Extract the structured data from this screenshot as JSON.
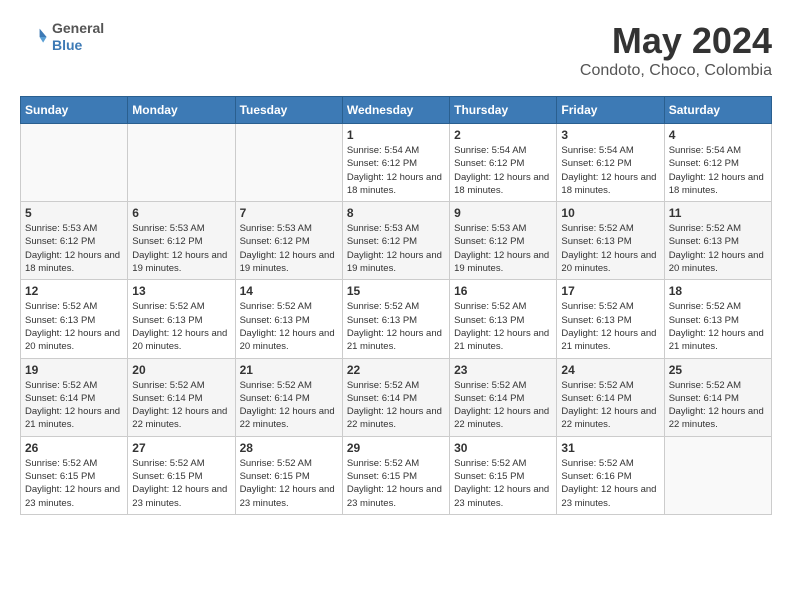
{
  "header": {
    "logo_line1": "General",
    "logo_line2": "Blue",
    "month": "May 2024",
    "location": "Condoto, Choco, Colombia"
  },
  "weekdays": [
    "Sunday",
    "Monday",
    "Tuesday",
    "Wednesday",
    "Thursday",
    "Friday",
    "Saturday"
  ],
  "weeks": [
    [
      {
        "day": "",
        "info": ""
      },
      {
        "day": "",
        "info": ""
      },
      {
        "day": "",
        "info": ""
      },
      {
        "day": "1",
        "info": "Sunrise: 5:54 AM\nSunset: 6:12 PM\nDaylight: 12 hours\nand 18 minutes."
      },
      {
        "day": "2",
        "info": "Sunrise: 5:54 AM\nSunset: 6:12 PM\nDaylight: 12 hours\nand 18 minutes."
      },
      {
        "day": "3",
        "info": "Sunrise: 5:54 AM\nSunset: 6:12 PM\nDaylight: 12 hours\nand 18 minutes."
      },
      {
        "day": "4",
        "info": "Sunrise: 5:54 AM\nSunset: 6:12 PM\nDaylight: 12 hours\nand 18 minutes."
      }
    ],
    [
      {
        "day": "5",
        "info": "Sunrise: 5:53 AM\nSunset: 6:12 PM\nDaylight: 12 hours\nand 18 minutes."
      },
      {
        "day": "6",
        "info": "Sunrise: 5:53 AM\nSunset: 6:12 PM\nDaylight: 12 hours\nand 19 minutes."
      },
      {
        "day": "7",
        "info": "Sunrise: 5:53 AM\nSunset: 6:12 PM\nDaylight: 12 hours\nand 19 minutes."
      },
      {
        "day": "8",
        "info": "Sunrise: 5:53 AM\nSunset: 6:12 PM\nDaylight: 12 hours\nand 19 minutes."
      },
      {
        "day": "9",
        "info": "Sunrise: 5:53 AM\nSunset: 6:12 PM\nDaylight: 12 hours\nand 19 minutes."
      },
      {
        "day": "10",
        "info": "Sunrise: 5:52 AM\nSunset: 6:13 PM\nDaylight: 12 hours\nand 20 minutes."
      },
      {
        "day": "11",
        "info": "Sunrise: 5:52 AM\nSunset: 6:13 PM\nDaylight: 12 hours\nand 20 minutes."
      }
    ],
    [
      {
        "day": "12",
        "info": "Sunrise: 5:52 AM\nSunset: 6:13 PM\nDaylight: 12 hours\nand 20 minutes."
      },
      {
        "day": "13",
        "info": "Sunrise: 5:52 AM\nSunset: 6:13 PM\nDaylight: 12 hours\nand 20 minutes."
      },
      {
        "day": "14",
        "info": "Sunrise: 5:52 AM\nSunset: 6:13 PM\nDaylight: 12 hours\nand 20 minutes."
      },
      {
        "day": "15",
        "info": "Sunrise: 5:52 AM\nSunset: 6:13 PM\nDaylight: 12 hours\nand 21 minutes."
      },
      {
        "day": "16",
        "info": "Sunrise: 5:52 AM\nSunset: 6:13 PM\nDaylight: 12 hours\nand 21 minutes."
      },
      {
        "day": "17",
        "info": "Sunrise: 5:52 AM\nSunset: 6:13 PM\nDaylight: 12 hours\nand 21 minutes."
      },
      {
        "day": "18",
        "info": "Sunrise: 5:52 AM\nSunset: 6:13 PM\nDaylight: 12 hours\nand 21 minutes."
      }
    ],
    [
      {
        "day": "19",
        "info": "Sunrise: 5:52 AM\nSunset: 6:14 PM\nDaylight: 12 hours\nand 21 minutes."
      },
      {
        "day": "20",
        "info": "Sunrise: 5:52 AM\nSunset: 6:14 PM\nDaylight: 12 hours\nand 22 minutes."
      },
      {
        "day": "21",
        "info": "Sunrise: 5:52 AM\nSunset: 6:14 PM\nDaylight: 12 hours\nand 22 minutes."
      },
      {
        "day": "22",
        "info": "Sunrise: 5:52 AM\nSunset: 6:14 PM\nDaylight: 12 hours\nand 22 minutes."
      },
      {
        "day": "23",
        "info": "Sunrise: 5:52 AM\nSunset: 6:14 PM\nDaylight: 12 hours\nand 22 minutes."
      },
      {
        "day": "24",
        "info": "Sunrise: 5:52 AM\nSunset: 6:14 PM\nDaylight: 12 hours\nand 22 minutes."
      },
      {
        "day": "25",
        "info": "Sunrise: 5:52 AM\nSunset: 6:14 PM\nDaylight: 12 hours\nand 22 minutes."
      }
    ],
    [
      {
        "day": "26",
        "info": "Sunrise: 5:52 AM\nSunset: 6:15 PM\nDaylight: 12 hours\nand 23 minutes."
      },
      {
        "day": "27",
        "info": "Sunrise: 5:52 AM\nSunset: 6:15 PM\nDaylight: 12 hours\nand 23 minutes."
      },
      {
        "day": "28",
        "info": "Sunrise: 5:52 AM\nSunset: 6:15 PM\nDaylight: 12 hours\nand 23 minutes."
      },
      {
        "day": "29",
        "info": "Sunrise: 5:52 AM\nSunset: 6:15 PM\nDaylight: 12 hours\nand 23 minutes."
      },
      {
        "day": "30",
        "info": "Sunrise: 5:52 AM\nSunset: 6:15 PM\nDaylight: 12 hours\nand 23 minutes."
      },
      {
        "day": "31",
        "info": "Sunrise: 5:52 AM\nSunset: 6:16 PM\nDaylight: 12 hours\nand 23 minutes."
      },
      {
        "day": "",
        "info": ""
      }
    ]
  ]
}
